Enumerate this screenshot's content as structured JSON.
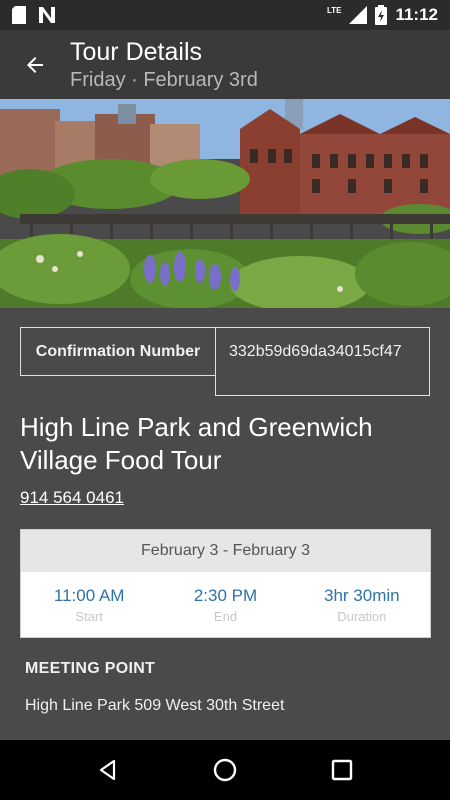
{
  "status_bar": {
    "time": "11:12",
    "network": "LTE",
    "icons": [
      "sim-card-icon",
      "notification-n-icon",
      "signal-icon",
      "battery-icon"
    ]
  },
  "app_bar": {
    "title": "Tour Details",
    "subtitle": "Friday · February 3rd",
    "back_icon": "arrow-left-icon"
  },
  "hero": {
    "icon": "park-photo"
  },
  "confirmation": {
    "label": "Confirmation Number",
    "value": "332b59d69da34015cf47"
  },
  "tour": {
    "title": "High Line Park and Greenwich Village Food Tour",
    "phone": "914 564 0461"
  },
  "dates": {
    "range": "February 3 - February 3",
    "start_value": "11:00 AM",
    "start_label": "Start",
    "end_value": "2:30 PM",
    "end_label": "End",
    "duration_value": "3hr 30min",
    "duration_label": "Duration"
  },
  "meeting": {
    "heading": "MEETING POINT",
    "address": "High Line Park 509 West 30th Street"
  },
  "nav": {
    "icons": [
      "back-triangle-icon",
      "home-circle-icon",
      "recents-square-icon"
    ]
  },
  "colors": {
    "background": "#4a4a4a",
    "app_bar": "#3a3a3a",
    "status_bar": "#2b2b2b",
    "accent": "#2e74a8"
  }
}
